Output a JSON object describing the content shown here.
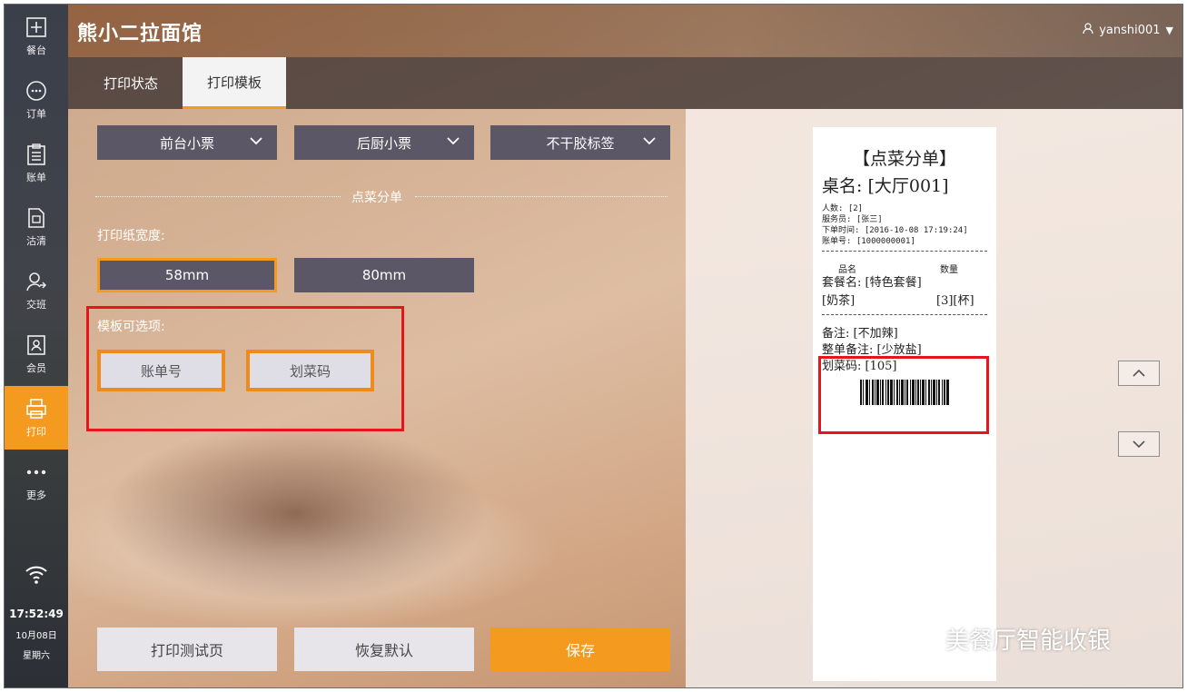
{
  "header": {
    "app_title": "熊小二拉面馆",
    "username": "yanshi001",
    "user_dropdown": "▼"
  },
  "sidebar": {
    "items": [
      {
        "label": "餐台",
        "icon": "plus-square-icon"
      },
      {
        "label": "订单",
        "icon": "chat-bubble-icon"
      },
      {
        "label": "账单",
        "icon": "clipboard-list-icon"
      },
      {
        "label": "沽清",
        "icon": "document-icon"
      },
      {
        "label": "交班",
        "icon": "user-switch-icon"
      },
      {
        "label": "会员",
        "icon": "member-card-icon"
      },
      {
        "label": "打印",
        "icon": "printer-icon"
      },
      {
        "label": "更多",
        "icon": "more-dots-icon"
      }
    ],
    "active": "打印",
    "time": "17:52:49",
    "date": "10月08日",
    "weekday": "星期六"
  },
  "tabs": [
    {
      "label": "打印状态"
    },
    {
      "label": "打印模板"
    }
  ],
  "active_tab": "打印模板",
  "ticket_types": [
    {
      "label": "前台小票"
    },
    {
      "label": "后厨小票"
    },
    {
      "label": "不干胶标签"
    }
  ],
  "section_label": "点菜分单",
  "paper_width": {
    "label": "打印纸宽度:",
    "options": [
      "58mm",
      "80mm"
    ],
    "selected": "58mm"
  },
  "template_options": {
    "label": "模板可选项:",
    "options": [
      "账单号",
      "划菜码"
    ]
  },
  "actions": {
    "test_print": "打印测试页",
    "restore_default": "恢复默认",
    "save": "保存"
  },
  "receipt": {
    "title": "【点菜分单】",
    "table": "桌名: [大厅001]",
    "guests": "人数: [2]",
    "waiter": "服务员: [张三]",
    "order_time": "下单时间: [2016-10-08 17:19:24]",
    "bill_no": "账单号: [1000000001]",
    "col_name": "品名",
    "col_qty": "数量",
    "set_meal": "套餐名: [特色套餐]",
    "item_name": "[奶茶]",
    "item_qty": "[3][杯]",
    "note": "备注: [不加辣]",
    "order_note": "整单备注: [少放盐]",
    "dish_code": "划菜码: [105]"
  },
  "watermark": "美餐厅智能收银",
  "colors": {
    "accent": "#f39a1f",
    "highlight_box": "#e8141b",
    "dropdown_bg": "#5b5766"
  }
}
